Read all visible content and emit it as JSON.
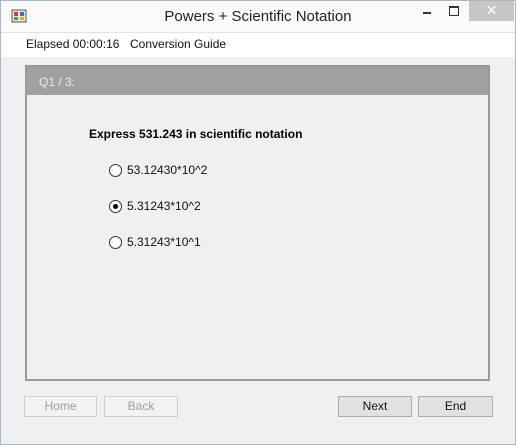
{
  "window": {
    "title": "Powers + Scientific Notation",
    "controls": {
      "minimize": "–",
      "maximize": "□",
      "close": "✕"
    },
    "icon": "app-icon"
  },
  "menu": {
    "elapsed": "Elapsed 00:00:16",
    "guide": "Conversion Guide"
  },
  "quiz": {
    "header": "Q1 / 3:",
    "question": "Express 531.243 in scientific notation",
    "options": [
      {
        "label": "53.12430*10^2",
        "selected": false
      },
      {
        "label": "5.31243*10^2",
        "selected": true
      },
      {
        "label": "5.31243*10^1",
        "selected": false
      }
    ]
  },
  "buttons": {
    "home": "Home",
    "back": "Back",
    "next": "Next",
    "end": "End"
  }
}
